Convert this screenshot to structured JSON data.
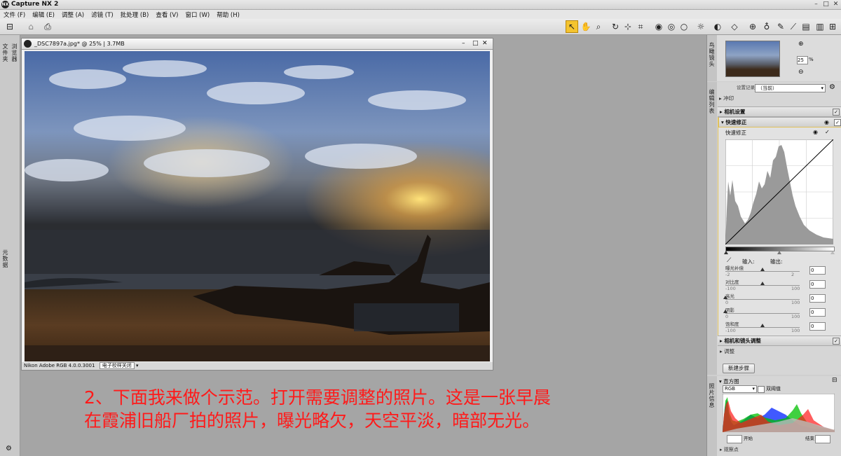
{
  "window": {
    "title": "Capture NX 2",
    "logo": "NX"
  },
  "menu": [
    "文件 (F)",
    "编辑 (E)",
    "调整 (A)",
    "滤镜 (T)",
    "批处理 (B)",
    "查看 (V)",
    "窗口 (W)",
    "帮助 (H)"
  ],
  "left_tabs": {
    "file": "文件夹",
    "browser": "浏览器",
    "meta": "元数据"
  },
  "image_window": {
    "title": "_DSC7897a.jpg* @ 25% | 3.7MB",
    "footer_profile": "Nikon Adobe RGB 4.0.0.3001",
    "footer_proof": "电子校样关闭"
  },
  "caption": {
    "line1": "2、下面我来做个示范。打开需要调整的照片。这是一张早晨",
    "line2": "在霞浦旧船厂拍的照片，曝光略欠，天空平淡，暗部无光。"
  },
  "birdseye": {
    "tab": "鸟瞰镜头",
    "zoom": "25",
    "percent": "%"
  },
  "edit_list": {
    "tab": "编辑列表",
    "version_label": "设置记录",
    "version_value": "（当前）",
    "develop": "冲印",
    "camera_settings": "相机设置",
    "quick_fix": "快速修正",
    "quick_fix_sub": "快速修正",
    "input_label": "输入:",
    "output_label": "输出:",
    "sliders": [
      {
        "label": "曝光补偿",
        "min": "-2",
        "max": "2",
        "value": "0",
        "pos": 0.5
      },
      {
        "label": "对比度",
        "min": "-100",
        "max": "100",
        "value": "0",
        "pos": 0.5
      },
      {
        "label": "高光",
        "min": "0",
        "max": "100",
        "value": "0",
        "pos": 0.0
      },
      {
        "label": "阴影",
        "min": "0",
        "max": "100",
        "value": "0",
        "pos": 0.0
      },
      {
        "label": "饱和度",
        "min": "-100",
        "max": "100",
        "value": "0",
        "pos": 0.5
      }
    ],
    "camera_lens": "相机和镜头调整",
    "adjust": "调整",
    "new_step": "新建步骤"
  },
  "histogram_panel": {
    "tab": "照片信息",
    "title": "直方图",
    "channel": "RGB",
    "threshold_label": "双阈值",
    "start_label": "开始",
    "end_label": "结束",
    "watch": "观察点"
  },
  "colors": {
    "accent": "#f4c430",
    "caption": "#ff1a1a",
    "panel_border": "#e0c15a"
  }
}
